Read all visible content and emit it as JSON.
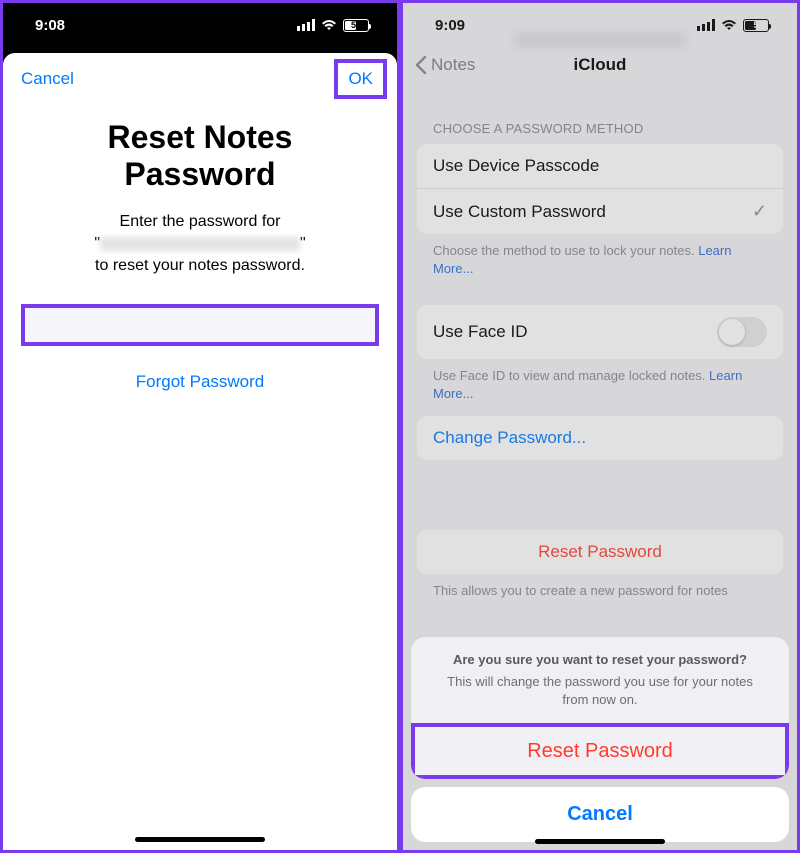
{
  "left": {
    "status": {
      "time": "9:08",
      "battery": "52",
      "battery_pct": 52
    },
    "modal": {
      "cancel": "Cancel",
      "ok": "OK",
      "title_line1": "Reset Notes",
      "title_line2": "Password",
      "sub_line1": "Enter the password for",
      "sub_line3": "to reset your notes password.",
      "forgot": "Forgot Password"
    }
  },
  "right": {
    "status": {
      "time": "9:09",
      "battery": "5",
      "battery_pct": 50
    },
    "nav": {
      "back": "Notes",
      "title": "iCloud"
    },
    "section1_header": "CHOOSE A PASSWORD METHOD",
    "option_device": "Use Device Passcode",
    "option_custom": "Use Custom Password",
    "footer1a": "Choose the method to use to lock your notes. ",
    "learn_more": "Learn More...",
    "faceid": "Use Face ID",
    "footer2a": "Use Face ID to view and manage locked notes. ",
    "change_pw": "Change Password...",
    "reset_pw": "Reset Password",
    "footer3": "This allows you to create a new password for notes",
    "sheet": {
      "title": "Are you sure you want to reset your password?",
      "body": "This will change the password you use for your notes from now on.",
      "action": "Reset Password",
      "cancel": "Cancel"
    }
  }
}
